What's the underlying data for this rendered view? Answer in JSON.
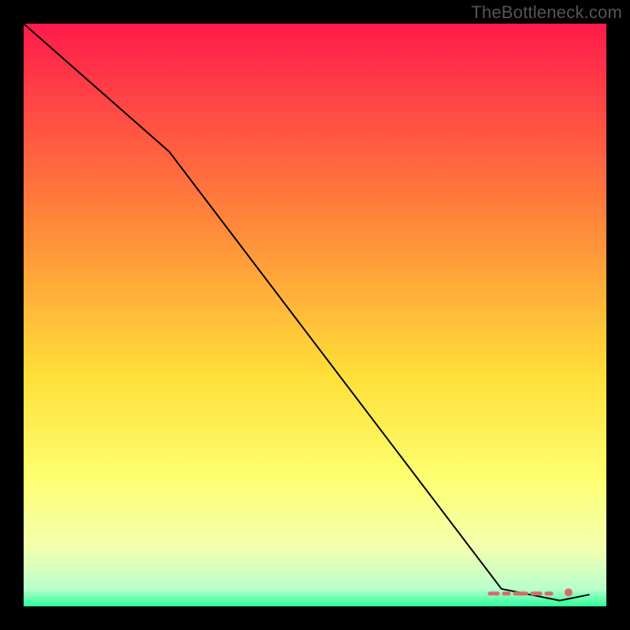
{
  "watermark": "TheBottleneck.com",
  "chart_data": {
    "type": "line",
    "title": "",
    "xlabel": "",
    "ylabel": "",
    "xlim": [
      0,
      100
    ],
    "ylim": [
      0,
      100
    ],
    "grid": false,
    "background_gradient": {
      "stops": [
        {
          "offset": 0.0,
          "color": "#ff1a4b"
        },
        {
          "offset": 0.35,
          "color": "#ff8a3a"
        },
        {
          "offset": 0.6,
          "color": "#ffde38"
        },
        {
          "offset": 0.78,
          "color": "#feff70"
        },
        {
          "offset": 0.9,
          "color": "#f3ffb0"
        },
        {
          "offset": 0.97,
          "color": "#b8ffcc"
        },
        {
          "offset": 1.0,
          "color": "#2bff9a"
        }
      ]
    },
    "series": [
      {
        "name": "main",
        "color": "#000000",
        "width": 2,
        "x": [
          0,
          25,
          82,
          92,
          97
        ],
        "y": [
          100,
          78,
          3,
          1,
          2
        ]
      }
    ],
    "markers": [
      {
        "name": "dash-band",
        "color": "#d86a6a",
        "x_start": 80,
        "x_end": 91,
        "y": 2.2,
        "style": "dashed",
        "width": 5
      },
      {
        "name": "end-dot",
        "color": "#d86a6a",
        "x": 93.5,
        "y": 2.4,
        "r": 5
      }
    ]
  }
}
